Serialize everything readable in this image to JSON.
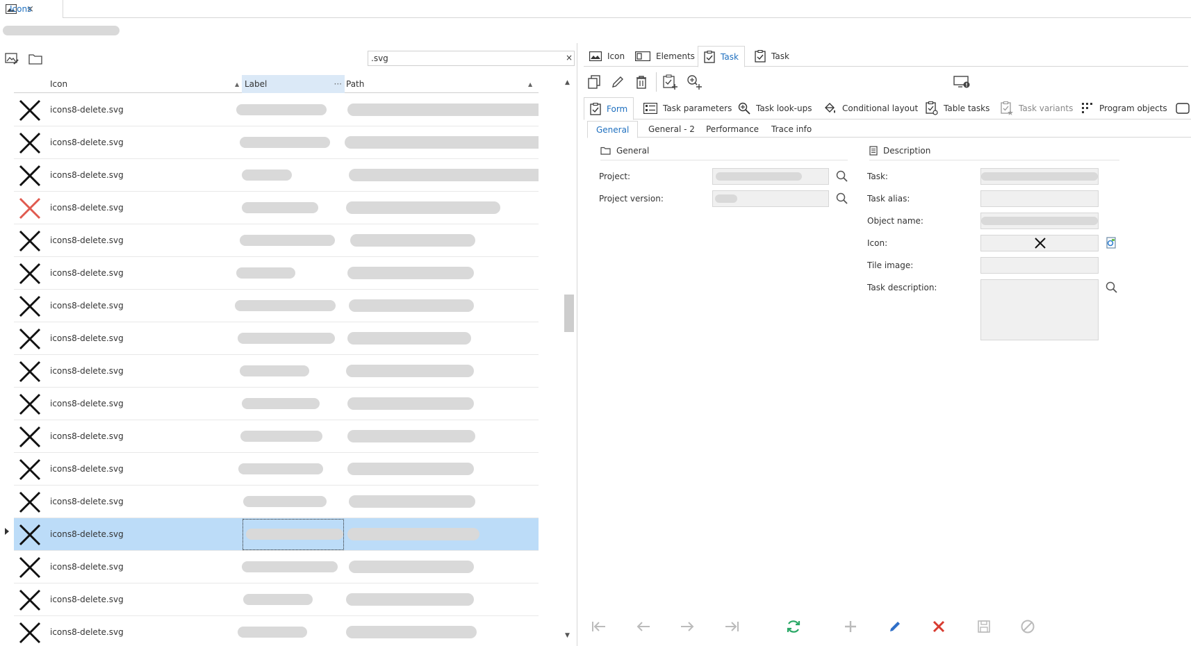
{
  "doc_tab": {
    "title": "Icons",
    "close": "×"
  },
  "left": {
    "search": {
      "value": ".svg",
      "clear": "×"
    },
    "columns": {
      "icon": "Icon",
      "label": "Label",
      "path": "Path"
    },
    "rows": [
      {
        "name": "icons8-delete.svg",
        "icon_color": "#111111"
      },
      {
        "name": "icons8-delete.svg",
        "icon_color": "#111111"
      },
      {
        "name": "icons8-delete.svg",
        "icon_color": "#111111"
      },
      {
        "name": "icons8-delete.svg",
        "icon_color": "#e05a4f"
      },
      {
        "name": "icons8-delete.svg",
        "icon_color": "#111111"
      },
      {
        "name": "icons8-delete.svg",
        "icon_color": "#111111"
      },
      {
        "name": "icons8-delete.svg",
        "icon_color": "#111111"
      },
      {
        "name": "icons8-delete.svg",
        "icon_color": "#111111"
      },
      {
        "name": "icons8-delete.svg",
        "icon_color": "#111111"
      },
      {
        "name": "icons8-delete.svg",
        "icon_color": "#111111"
      },
      {
        "name": "icons8-delete.svg",
        "icon_color": "#111111"
      },
      {
        "name": "icons8-delete.svg",
        "icon_color": "#111111"
      },
      {
        "name": "icons8-delete.svg",
        "icon_color": "#111111"
      },
      {
        "name": "icons8-delete.svg",
        "icon_color": "#111111",
        "selected": true
      },
      {
        "name": "icons8-delete.svg",
        "icon_color": "#111111"
      },
      {
        "name": "icons8-delete.svg",
        "icon_color": "#111111"
      },
      {
        "name": "icons8-delete.svg",
        "icon_color": "#111111"
      }
    ]
  },
  "right": {
    "tabs": [
      "Icon",
      "Elements",
      "Task",
      "Task"
    ],
    "form_tabs": [
      "Form",
      "Task parameters",
      "Task look-ups",
      "Conditional layout",
      "Table tasks",
      "Task variants",
      "Program objects"
    ],
    "sub_tabs": [
      "General",
      "General - 2",
      "Performance",
      "Trace info"
    ],
    "general_group": "General",
    "description_group": "Description",
    "labels": {
      "project": "Project:",
      "project_version": "Project version:",
      "task": "Task:",
      "task_alias": "Task alias:",
      "object_name": "Object name:",
      "icon": "Icon:",
      "tile_image": "Tile image:",
      "task_description": "Task description:"
    }
  },
  "colors": {
    "accent": "#1e6fbf",
    "selected_row": "#bcdcf8",
    "refresh": "#2aa866",
    "delete": "#d83b30",
    "edit": "#2f6fc8"
  }
}
